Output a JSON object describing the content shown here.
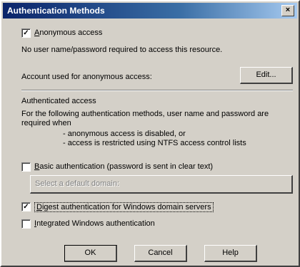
{
  "window": {
    "title": "Authentication Methods",
    "close_glyph": "×"
  },
  "anonymous": {
    "checkbox_label": "Anonymous access",
    "checked": true,
    "description": "No user name/password required to access this resource.",
    "account_label": "Account used for anonymous access:",
    "edit_button": "Edit..."
  },
  "authenticated": {
    "heading": "Authenticated access",
    "description": "For the following authentication methods, user name and password are required when",
    "bullet1": "- anonymous access is disabled, or",
    "bullet2": "- access is restricted using NTFS access control lists",
    "basic_label": "Basic authentication (password is sent in clear text)",
    "basic_checked": false,
    "default_domain_label": "Select a default domain:",
    "digest_label": "Digest authentication for Windows domain servers",
    "digest_checked": true,
    "integrated_label": "Integrated Windows authentication",
    "integrated_checked": false
  },
  "buttons": {
    "ok": "OK",
    "cancel": "Cancel",
    "help": "Help"
  },
  "check_glyph": "✓"
}
